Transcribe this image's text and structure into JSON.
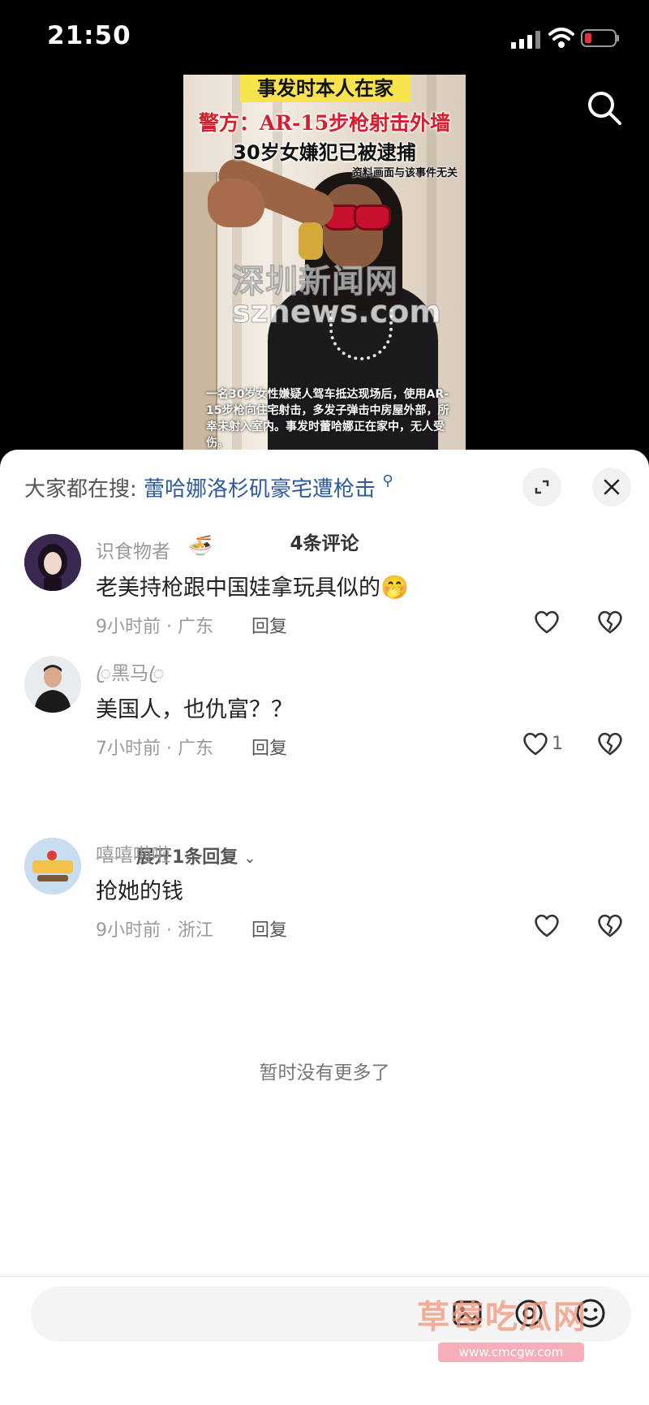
{
  "status": {
    "time": "21:50"
  },
  "video": {
    "title_tag": "事发时本人在家",
    "headline_red": "警方：AR-15步枪射击外墙",
    "headline_black": "30岁女嫌犯已被逮捕",
    "disclaimer": "资料画面与该事件无关",
    "watermark_cn": "深圳新闻网",
    "watermark_en": "sznews.com",
    "caption": "一名30岁女性嫌疑人驾车抵达现场后，使用AR-15步枪向住宅射击，多发子弹击中房屋外部，所幸未射入室内。事发时蕾哈娜正在家中，无人受伤。"
  },
  "sheet": {
    "hot_search_label": "大家都在搜:",
    "hot_search_term": "蕾哈娜洛杉矶豪宅遭枪击",
    "comment_count": "4条评论",
    "reply_label": "回复",
    "no_more": "暂时没有更多了",
    "expand_replies": "展开1条回复",
    "comments": [
      {
        "user": "识食物者",
        "text": "老美持枪跟中国娃拿玩具似的",
        "meta": "9小时前 · 广东",
        "likes": ""
      },
      {
        "user": "ꦿ黑马ꦿ",
        "text": "美国人，也仇富？？",
        "meta": "7小时前 · 广东",
        "likes": "1"
      },
      {
        "user": "嘻嘻啦啦",
        "text": "抢她的钱",
        "meta": "9小时前 · 浙江",
        "likes": ""
      }
    ]
  },
  "watermark": {
    "site_name": "草莓吃瓜网",
    "site_url": "www.cmcgw.com"
  }
}
